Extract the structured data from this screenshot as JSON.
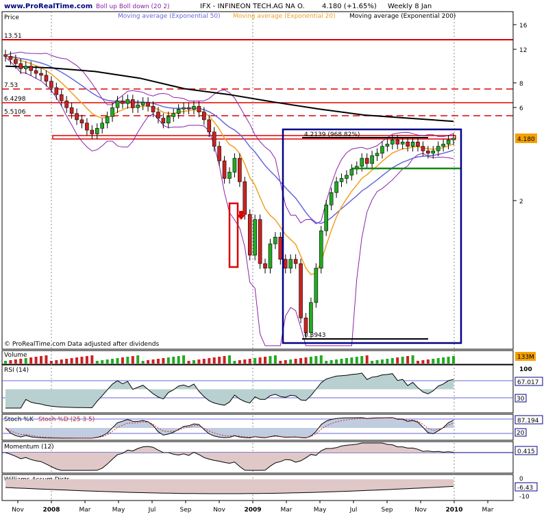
{
  "header": {
    "site": "www.ProRealTime.com",
    "legend_boll": "Boll up Boll down (20 2)",
    "legend_ema50": "Moving average (Exponential 50)",
    "title": "IFX - INFINEON TECH.AG NA O.",
    "price_change": "4.180 (+1.65%)",
    "period": "Weekly 8 Jan",
    "legend_ema20": "Moving average (Exponential 20)",
    "legend_ema200": "Moving average (Exponential 200)"
  },
  "price_panel": {
    "label": "Price",
    "footer": "© ProRealTime.com  Data adjusted after dividends",
    "current_label": "4.180",
    "left_labels": [
      "13.51",
      "7.53",
      "6.4298",
      "5.5106"
    ],
    "box_top_label": "4.2139 (968.82%)",
    "box_bottom_label": "0.3943",
    "y_ticks": [
      "16",
      "12",
      "8",
      "6",
      "2"
    ]
  },
  "volume_panel": {
    "label": "Volume",
    "value": "133M"
  },
  "rsi_panel": {
    "label": "RSI (14)",
    "value": "67.017",
    "top": "100",
    "level": "30"
  },
  "stoch_panel": {
    "label_k": "Stoch %K",
    "label_d": "Stoch %D (25 3 5)",
    "value": "87.194",
    "level": "20"
  },
  "momentum_panel": {
    "label": "Momentum (12)",
    "value": "0.415"
  },
  "williams_panel": {
    "label": "Williams Accum Distr",
    "value": "-6.43",
    "top": "0",
    "bottom": "-10"
  },
  "x_axis": [
    "Nov",
    "2008",
    "Mar",
    "May",
    "Jul",
    "Sep",
    "Nov",
    "2009",
    "Mar",
    "May",
    "Jul",
    "Sep",
    "Nov",
    "2010",
    "Mar"
  ],
  "colors": {
    "bull": "#22aa22",
    "bear": "#cc2222",
    "ema20": "#f0a020",
    "ema50": "#6666dd",
    "ema200": "#000000",
    "boll": "#8822aa",
    "box": "#000088",
    "hline": "#dd0000"
  },
  "chart_data": {
    "type": "candlestick",
    "title": "IFX - INFINEON TECH.AG NA O.",
    "y_scale": "log",
    "ylim": [
      0.35,
      17
    ],
    "close_series": [
      11.0,
      10.6,
      10.1,
      9.5,
      9.8,
      9.3,
      9.0,
      8.8,
      8.2,
      7.6,
      7.0,
      6.5,
      6.0,
      5.6,
      5.2,
      5.0,
      4.6,
      4.4,
      4.7,
      5.0,
      5.4,
      6.0,
      6.5,
      6.3,
      6.6,
      6.0,
      6.2,
      6.4,
      6.1,
      5.7,
      5.3,
      5.0,
      5.4,
      5.6,
      5.9,
      6.0,
      5.9,
      6.1,
      5.7,
      5.2,
      4.5,
      3.8,
      3.2,
      2.6,
      2.8,
      3.3,
      2.5,
      1.7,
      1.05,
      1.6,
      0.95,
      0.9,
      1.2,
      1.3,
      1.0,
      0.9,
      1.0,
      0.95,
      0.5,
      0.42,
      0.6,
      0.9,
      1.4,
      1.9,
      2.2,
      2.5,
      2.6,
      2.7,
      2.9,
      3.0,
      3.3,
      3.1,
      3.4,
      3.5,
      3.8,
      3.9,
      4.1,
      3.9,
      4.0,
      3.8,
      4.0,
      3.8,
      3.6,
      3.5,
      3.6,
      3.8,
      3.9,
      4.1,
      4.18
    ],
    "ema200_series": [
      9.8,
      9.6,
      9.2,
      8.5,
      7.5,
      7.0,
      6.4,
      5.9,
      5.5,
      5.3,
      5.1
    ],
    "horizontal_levels": [
      13.51,
      7.53,
      6.4298,
      5.5106,
      4.2139,
      3.3
    ],
    "annotations": [
      "4.2139 (968.82%)",
      "0.3943"
    ],
    "rsi_current": 67.017,
    "stoch_current": 87.194,
    "momentum_current": 0.415,
    "williams_current": -6.43,
    "volume_current": "133M"
  }
}
